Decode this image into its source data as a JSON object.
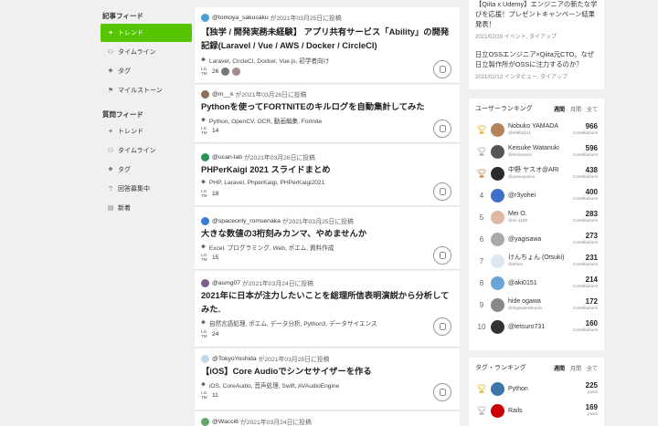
{
  "sidebar": {
    "section1": "記事フィード",
    "section1_items": [
      {
        "label": "トレンド",
        "icon": "✦"
      },
      {
        "label": "タイムライン",
        "icon": "⚇"
      },
      {
        "label": "タグ",
        "icon": "⬥"
      },
      {
        "label": "マイルストーン",
        "icon": "⚑"
      }
    ],
    "section2": "質問フィード",
    "section2_items": [
      {
        "label": "トレンド",
        "icon": "✦"
      },
      {
        "label": "タイムライン",
        "icon": "⚇"
      },
      {
        "label": "タグ",
        "icon": "⬥"
      },
      {
        "label": "回答募集中",
        "icon": "?"
      },
      {
        "label": "新着",
        "icon": "▤"
      }
    ]
  },
  "feed": [
    {
      "user": "@tomoya_sakusaku",
      "date": "が2021年03月25日に投稿",
      "title": "【独学 / 開発実務未経験】 アプリ共有サービス「Ability」の開発記録(Laravel / Vue / AWS / Docker / CircleCI)",
      "tags": "Laravel, CircleCI, Docker, Vue.js, 初学者向け",
      "lgtm": "26",
      "avatar": "#4a9fd6"
    },
    {
      "user": "@m__k",
      "date": "が2021年03月26日に投稿",
      "title": "Pythonを使ってFORTNITEのキルログを自動集計してみた",
      "tags": "Python, OpenCV, OCR, 動画編集, Fortnite",
      "lgtm": "14",
      "avatar": "#8a6f5a"
    },
    {
      "user": "@ucan-lab",
      "date": "が2021年03月26日に投稿",
      "title": "PHPerKaigi 2021 スライドまとめ",
      "tags": "PHP, Laravel, PhperKaigi, PHPerKaigi2021",
      "lgtm": "18",
      "avatar": "#2f8f5a"
    },
    {
      "user": "@spaceonly_romsenaka",
      "date": "が2021年03月25日に投稿",
      "title": "大きな数値の3桁刻みカンマ、やめませんか",
      "tags": "Excel, プログラミング, Web, ポエム, 資料作成",
      "lgtm": "15",
      "avatar": "#3a7bd5"
    },
    {
      "user": "@asmg07",
      "date": "が2021年03月24日に投稿",
      "title": "2021年に日本が注力したいことを総理所信表明演説から分析してみた.",
      "tags": "自然言語処理, ポエム, データ分析, Python3, データサイエンス",
      "lgtm": "24",
      "avatar": "#7a5c8e"
    },
    {
      "user": "@TokyoYoshida",
      "date": "が2021年03月25日に投稿",
      "title": "【iOS】Core Audioでシンセサイザーを作る",
      "tags": "iOS, CoreAudio, 音声処理, Swift, AVAudioEngine",
      "lgtm": "11",
      "avatar": "#c0d8e8"
    },
    {
      "user": "@Wacci6",
      "date": "が2021年03月24日に投稿",
      "title": "",
      "tags": "",
      "lgtm": "",
      "avatar": "#5fa86a"
    }
  ],
  "news": [
    {
      "title": "【Qiita x Udemy】エンジニアの新たな学びを応援！プレゼントキャンペーン結果発表！",
      "meta": "2021/02/19 イベント, タイアップ"
    },
    {
      "title": "日立OSSエンジニア×Qiita元CTO。なぜ日立製作所がOSSに注力するのか？",
      "meta": "2021/02/12 インタビュー, タイアップ"
    }
  ],
  "user_ranking": {
    "label": "ユーザーランキング",
    "periods": [
      "週間",
      "月間",
      "全て"
    ],
    "rows": [
      {
        "rank": "1",
        "name": "Nobuko YAMADA",
        "id": "@e99h2121",
        "score": "966",
        "unit": "Contributions",
        "trophy": "gold",
        "avatar": "#b5835a"
      },
      {
        "rank": "2",
        "name": "Keisuke Watanuki",
        "id": "@knoxxxxxx",
        "score": "596",
        "unit": "Contributions",
        "trophy": "silver",
        "avatar": "#555"
      },
      {
        "rank": "3",
        "name": "中野 ヤスオ@ARI",
        "id": "@yasuoyasuo",
        "score": "438",
        "unit": "Contributions",
        "trophy": "bronze",
        "avatar": "#2b2b2b"
      },
      {
        "rank": "4",
        "name": "@r3yohei",
        "id": "",
        "score": "400",
        "unit": "Contributions",
        "trophy": "",
        "avatar": "#3e6fc9"
      },
      {
        "rank": "5",
        "name": "Mei O.",
        "id": "@mi-1109",
        "score": "283",
        "unit": "Contributions",
        "trophy": "",
        "avatar": "#e0b7a0"
      },
      {
        "rank": "6",
        "name": "@yagisawa",
        "id": "",
        "score": "273",
        "unit": "Contributions",
        "trophy": "",
        "avatar": "#aaa"
      },
      {
        "rank": "7",
        "name": "けんちょん (Otsuki)",
        "id": "@drken",
        "score": "231",
        "unit": "Contributions",
        "trophy": "",
        "avatar": "#dde8f0"
      },
      {
        "rank": "8",
        "name": "@aki0151",
        "id": "",
        "score": "214",
        "unit": "Contributions",
        "trophy": "",
        "avatar": "#6aa5d8"
      },
      {
        "rank": "9",
        "name": "hide ogawa",
        "id": "@OgawaHideyuki",
        "score": "172",
        "unit": "Contributions",
        "trophy": "",
        "avatar": "#888"
      },
      {
        "rank": "10",
        "name": "@tetsuro731",
        "id": "",
        "score": "160",
        "unit": "Contributions",
        "trophy": "",
        "avatar": "#333"
      }
    ]
  },
  "tag_ranking": {
    "label": "タグ・ランキング",
    "periods": [
      "週間",
      "月間",
      "全て"
    ],
    "rows": [
      {
        "rank": "1",
        "name": "Python",
        "score": "225",
        "unit": "posts",
        "trophy": "gold",
        "avatar": "#3b77a8"
      },
      {
        "rank": "2",
        "name": "Rails",
        "score": "169",
        "unit": "posts",
        "trophy": "silver",
        "avatar": "#cc0000"
      }
    ]
  },
  "colors": {
    "accent": "#55c500",
    "gold": "#e0a800",
    "silver": "#9aa0a6",
    "bronze": "#b8733b"
  }
}
